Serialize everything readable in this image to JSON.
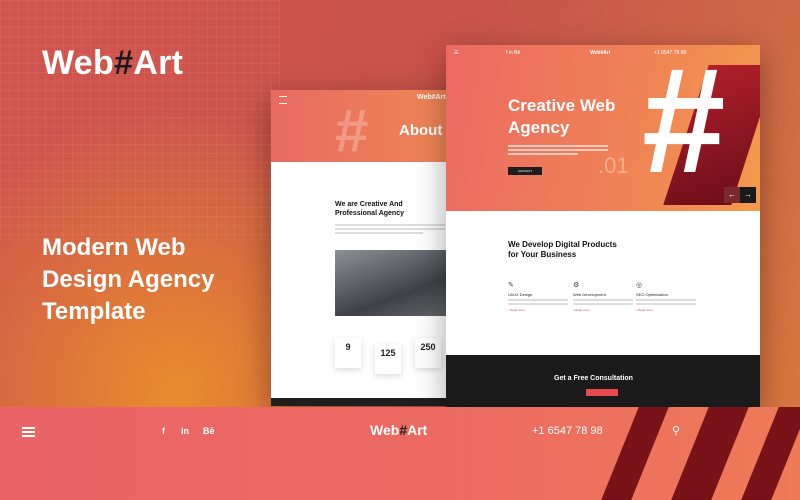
{
  "brand": {
    "name_left": "Web",
    "hash": "#",
    "name_right": "Art"
  },
  "tagline": "Modern Web Design Agency Template",
  "left_mock": {
    "logo": "Web#Art",
    "about": "About u",
    "heading": "We are Creative And Professional Agency",
    "stats": [
      "9",
      "125",
      "250"
    ]
  },
  "right_mock": {
    "logo": "Web#Art",
    "phone": "+1 6547 78 98",
    "social": "f  in  Bē",
    "hero_title": "Creative Web Agency",
    "cta_btn": "CONTACT",
    "hero_number": ".01",
    "arrows": [
      "←",
      "→"
    ],
    "section_title": "We Develop Digital Products for Your Business",
    "services": [
      {
        "icon": "✎",
        "title": "UI/UX Design",
        "link": "• Read more"
      },
      {
        "icon": "⚙",
        "title": "Web Development",
        "link": "• Read more"
      },
      {
        "icon": "◎",
        "title": "SEO Optimization",
        "link": "• Read more"
      }
    ],
    "consult": "Get a Free Consultation"
  },
  "bottom_bar": {
    "social": [
      "f",
      "in",
      "Bē"
    ],
    "logo_left": "Web",
    "logo_hash": "#",
    "logo_right": "Art",
    "phone": "+1 6547 78 98",
    "search_icon": "⚲"
  },
  "colors": {
    "accent": "#ea6468",
    "dark": "#1a1a1a",
    "orange": "#f08a52"
  }
}
